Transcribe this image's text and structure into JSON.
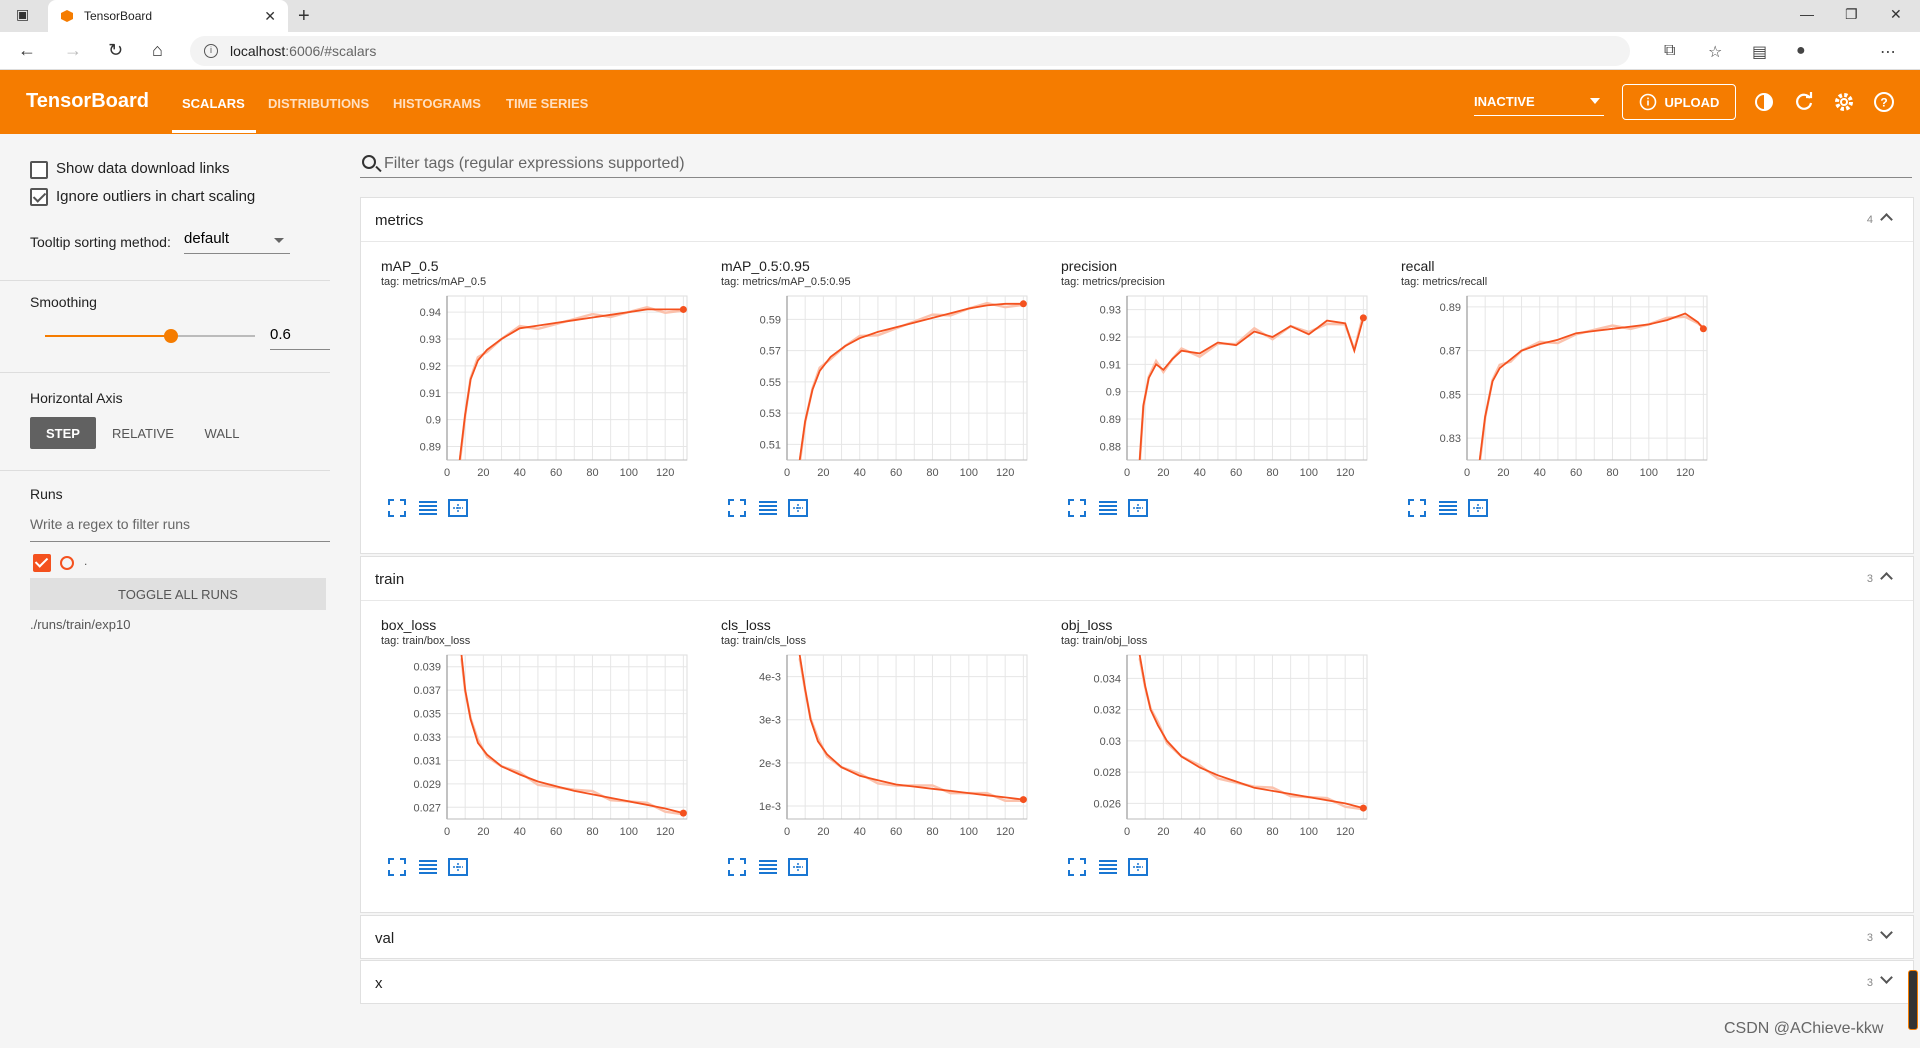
{
  "browser": {
    "tab_title": "TensorBoard",
    "url_host": "localhost",
    "url_rest": ":6006/#scalars",
    "tab_close_glyph": "✕",
    "new_tab_glyph": "+",
    "win_min": "—",
    "win_max": "❐",
    "win_close": "✕",
    "back_glyph": "←",
    "forward_glyph": "→",
    "reload_glyph": "↻",
    "home_glyph": "⌂"
  },
  "header": {
    "title": "TensorBoard",
    "tabs": [
      "SCALARS",
      "DISTRIBUTIONS",
      "HISTOGRAMS",
      "TIME SERIES"
    ],
    "status": "INACTIVE",
    "upload": "UPLOAD"
  },
  "sidebar": {
    "show_download": "Show data download links",
    "ignore_outliers": "Ignore outliers in chart scaling",
    "show_download_checked": false,
    "ignore_outliers_checked": true,
    "tooltip_label": "Tooltip sorting method:",
    "tooltip_value": "default",
    "smoothing_label": "Smoothing",
    "smoothing_value": "0.6",
    "smoothing_fraction": 0.6,
    "haxis_label": "Horizontal Axis",
    "haxis_options": [
      "STEP",
      "RELATIVE",
      "WALL"
    ],
    "haxis_selected": "STEP",
    "runs_label": "Runs",
    "runs_filter_placeholder": "Write a regex to filter runs",
    "run_name": ".",
    "toggle_all": "TOGGLE ALL RUNS",
    "run_path": "./runs/train/exp10"
  },
  "main": {
    "filter_placeholder": "Filter tags (regular expressions supported)",
    "sections": [
      {
        "name": "metrics",
        "count": "4",
        "expanded": true
      },
      {
        "name": "train",
        "count": "3",
        "expanded": true
      },
      {
        "name": "val",
        "count": "3",
        "expanded": false
      },
      {
        "name": "x",
        "count": "3",
        "expanded": false
      }
    ]
  },
  "colors": {
    "accent": "#f57c00",
    "series": "#f4511e",
    "series_raw": "#fbc2ad"
  },
  "watermark": "CSDN @AChieve-kkw",
  "chart_data": [
    {
      "type": "line",
      "title": "mAP_0.5",
      "tag": "tag: metrics/mAP_0.5",
      "xlim": [
        0,
        132
      ],
      "xticks": [
        0,
        20,
        40,
        60,
        80,
        100,
        120
      ],
      "ylim": [
        0.885,
        0.946
      ],
      "yticks": [
        0.89,
        0.9,
        0.91,
        0.92,
        0.93,
        0.94
      ],
      "ytick_labels": [
        "0.89",
        "0.9",
        "0.91",
        "0.92",
        "0.93",
        "0.94"
      ],
      "x": [
        7,
        10,
        13,
        17,
        22,
        30,
        40,
        50,
        60,
        70,
        80,
        90,
        100,
        110,
        120,
        130
      ],
      "y": [
        0.885,
        0.902,
        0.915,
        0.922,
        0.926,
        0.93,
        0.934,
        0.935,
        0.936,
        0.937,
        0.938,
        0.939,
        0.94,
        0.941,
        0.941,
        0.941
      ]
    },
    {
      "type": "line",
      "title": "mAP_0.5:0.95",
      "tag": "tag: metrics/mAP_0.5:0.95",
      "xlim": [
        0,
        132
      ],
      "xticks": [
        0,
        20,
        40,
        60,
        80,
        100,
        120
      ],
      "ylim": [
        0.5,
        0.605
      ],
      "yticks": [
        0.51,
        0.53,
        0.55,
        0.57,
        0.59
      ],
      "ytick_labels": [
        "0.51",
        "0.53",
        "0.55",
        "0.57",
        "0.59"
      ],
      "x": [
        7,
        10,
        14,
        18,
        24,
        32,
        40,
        50,
        60,
        70,
        80,
        90,
        100,
        110,
        120,
        130
      ],
      "y": [
        0.5,
        0.525,
        0.545,
        0.557,
        0.566,
        0.573,
        0.578,
        0.582,
        0.585,
        0.588,
        0.591,
        0.594,
        0.597,
        0.599,
        0.6,
        0.6
      ]
    },
    {
      "type": "line",
      "title": "precision",
      "tag": "tag: metrics/precision",
      "xlim": [
        0,
        132
      ],
      "xticks": [
        0,
        20,
        40,
        60,
        80,
        100,
        120
      ],
      "ylim": [
        0.875,
        0.935
      ],
      "yticks": [
        0.88,
        0.89,
        0.9,
        0.91,
        0.92,
        0.93
      ],
      "ytick_labels": [
        "0.88",
        "0.89",
        "0.9",
        "0.91",
        "0.92",
        "0.93"
      ],
      "x": [
        7,
        9,
        12,
        16,
        20,
        25,
        30,
        40,
        50,
        60,
        70,
        80,
        90,
        100,
        110,
        120,
        125,
        130
      ],
      "y": [
        0.875,
        0.895,
        0.905,
        0.91,
        0.908,
        0.912,
        0.915,
        0.914,
        0.918,
        0.917,
        0.922,
        0.92,
        0.924,
        0.921,
        0.926,
        0.925,
        0.915,
        0.927
      ]
    },
    {
      "type": "line",
      "title": "recall",
      "tag": "tag: metrics/recall",
      "xlim": [
        0,
        132
      ],
      "xticks": [
        0,
        20,
        40,
        60,
        80,
        100,
        120
      ],
      "ylim": [
        0.82,
        0.895
      ],
      "yticks": [
        0.83,
        0.85,
        0.87,
        0.89
      ],
      "ytick_labels": [
        "0.83",
        "0.85",
        "0.87",
        "0.89"
      ],
      "x": [
        7,
        10,
        14,
        18,
        24,
        30,
        40,
        50,
        60,
        70,
        80,
        90,
        100,
        110,
        120,
        127,
        130
      ],
      "y": [
        0.82,
        0.84,
        0.856,
        0.862,
        0.866,
        0.87,
        0.873,
        0.875,
        0.878,
        0.879,
        0.88,
        0.881,
        0.882,
        0.884,
        0.887,
        0.883,
        0.88
      ]
    },
    {
      "type": "line",
      "title": "box_loss",
      "tag": "tag: train/box_loss",
      "xlim": [
        0,
        132
      ],
      "xticks": [
        0,
        20,
        40,
        60,
        80,
        100,
        120
      ],
      "ylim": [
        0.026,
        0.04
      ],
      "yticks": [
        0.027,
        0.029,
        0.031,
        0.033,
        0.035,
        0.037,
        0.039
      ],
      "ytick_labels": [
        "0.027",
        "0.029",
        "0.031",
        "0.033",
        "0.035",
        "0.037",
        "0.039"
      ],
      "x": [
        8,
        10,
        13,
        17,
        22,
        30,
        40,
        50,
        60,
        70,
        80,
        90,
        100,
        110,
        120,
        130
      ],
      "y": [
        0.04,
        0.037,
        0.0345,
        0.0325,
        0.0315,
        0.0305,
        0.0298,
        0.0292,
        0.0288,
        0.0284,
        0.0281,
        0.0278,
        0.0275,
        0.0272,
        0.0269,
        0.0265
      ]
    },
    {
      "type": "line",
      "title": "cls_loss",
      "tag": "tag: train/cls_loss",
      "xlim": [
        0,
        132
      ],
      "xticks": [
        0,
        20,
        40,
        60,
        80,
        100,
        120
      ],
      "ylim": [
        0.0007,
        0.0045
      ],
      "yticks": [
        0.001,
        0.002,
        0.003,
        0.004
      ],
      "ytick_labels": [
        "1e-3",
        "2e-3",
        "3e-3",
        "4e-3"
      ],
      "x": [
        7,
        10,
        13,
        17,
        22,
        30,
        40,
        50,
        60,
        70,
        80,
        90,
        100,
        110,
        120,
        130
      ],
      "y": [
        0.0045,
        0.0037,
        0.003,
        0.0025,
        0.0022,
        0.0019,
        0.0017,
        0.0016,
        0.0015,
        0.00145,
        0.0014,
        0.00135,
        0.0013,
        0.00125,
        0.0012,
        0.00115
      ]
    },
    {
      "type": "line",
      "title": "obj_loss",
      "tag": "tag: train/obj_loss",
      "xlim": [
        0,
        132
      ],
      "xticks": [
        0,
        20,
        40,
        60,
        80,
        100,
        120
      ],
      "ylim": [
        0.025,
        0.0355
      ],
      "yticks": [
        0.026,
        0.028,
        0.03,
        0.032,
        0.034
      ],
      "ytick_labels": [
        "0.026",
        "0.028",
        "0.03",
        "0.032",
        "0.034"
      ],
      "x": [
        7,
        10,
        13,
        17,
        22,
        30,
        40,
        50,
        60,
        70,
        80,
        90,
        100,
        110,
        120,
        130
      ],
      "y": [
        0.0355,
        0.0335,
        0.032,
        0.031,
        0.03,
        0.029,
        0.0283,
        0.0278,
        0.0274,
        0.027,
        0.0268,
        0.0266,
        0.0264,
        0.0262,
        0.026,
        0.0257
      ]
    }
  ]
}
